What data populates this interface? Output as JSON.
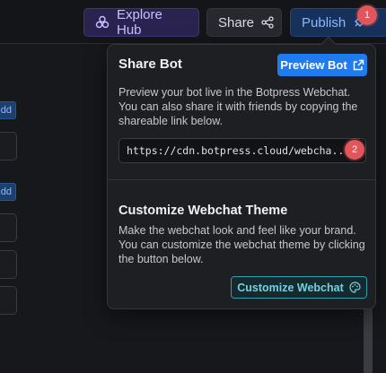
{
  "topbar": {
    "explore_label": "Explore Hub",
    "share_label": "Share",
    "publish_label": "Publish",
    "publish_badge": "1",
    "colors": {
      "explore": "#c9c0ff",
      "share": "#d9dbe0",
      "publish": "#8cb8ff",
      "badge": "#e0565b"
    }
  },
  "left_panel": {
    "add_label_1": "dd",
    "add_label_2": "dd"
  },
  "share_popover": {
    "title": "Share Bot",
    "preview_button_label": "Preview Bot",
    "description": "Preview your bot live in the Botpress Webchat. You can also share it with friends by copying the shareable link below.",
    "share_url": "https://cdn.botpress.cloud/webcha",
    "share_url_ellipsis": "...",
    "url_badge": "2",
    "customize_title": "Customize Webchat Theme",
    "customize_description": "Make the webchat look and feel like your brand. You can customize the webchat theme by clicking the button below.",
    "customize_button_label": "Customize Webchat",
    "colors": {
      "primary": "#1f7cf0",
      "customize": "#6fd3e0"
    }
  }
}
